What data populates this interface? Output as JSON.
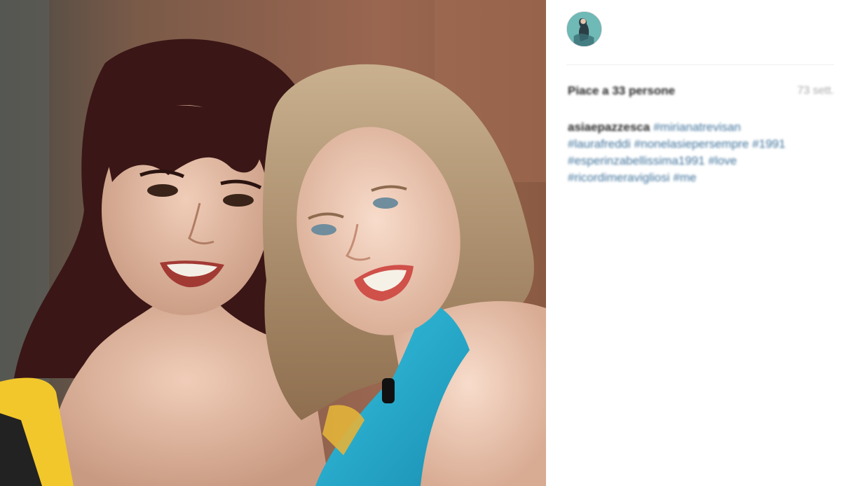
{
  "post": {
    "likes_text": "Piace a 33 persone",
    "time_text": "73 sett.",
    "username": "asiaepazzesca",
    "caption_lines": [
      [
        "#mirianatrevisan"
      ],
      [
        "#laurafreddi",
        "#nonelasiepersempre",
        "#1991"
      ],
      [
        "#esperinzabellissima1991",
        "#love"
      ],
      [
        "#ricordimeravigliosi",
        "#me"
      ]
    ]
  },
  "colors": {
    "hashtag": "#3f729b",
    "text": "#262626",
    "muted": "#a8a8a8"
  },
  "icons": {
    "avatar": "profile-avatar"
  }
}
